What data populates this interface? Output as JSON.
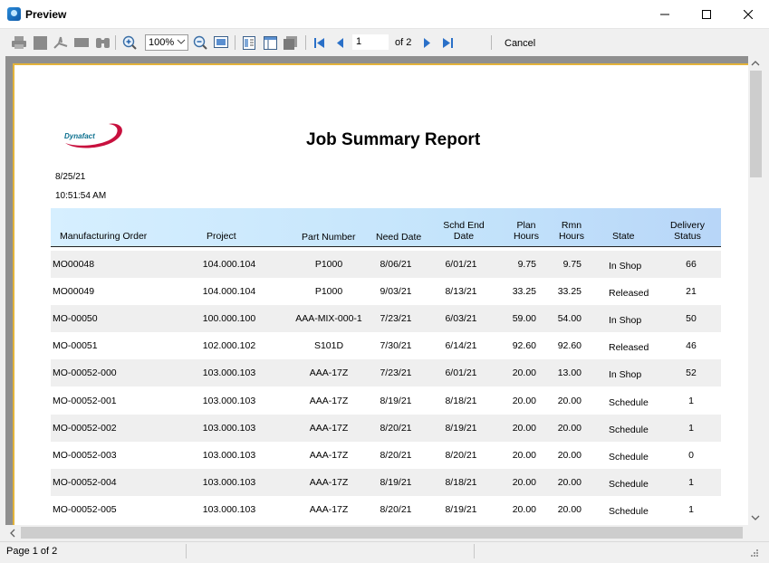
{
  "window": {
    "title": "Preview"
  },
  "toolbar": {
    "zoom_value": "100%",
    "page_number": "1",
    "page_of": "of 2",
    "cancel_label": "Cancel"
  },
  "report": {
    "logo_text": "Dynafact",
    "title": "Job Summary Report",
    "date": "8/25/21",
    "time": "10:51:54 AM",
    "columns": {
      "mo": "Manufacturing Order",
      "project": "Project",
      "part": "Part Number",
      "need": "Need Date",
      "schd_1": "Schd End",
      "schd_2": "Date",
      "plan_1": "Plan",
      "plan_2": "Hours",
      "rmn_1": "Rmn",
      "rmn_2": "Hours",
      "state": "State",
      "delivery_1": "Delivery",
      "delivery_2": "Status"
    },
    "rows": [
      {
        "mo": "MO00048",
        "project": "104.000.104",
        "part": "P1000",
        "need": "8/06/21",
        "schd": "6/01/21",
        "plan": "9.75",
        "rmn": "9.75",
        "state": "In Shop",
        "status": "66"
      },
      {
        "mo": "MO00049",
        "project": "104.000.104",
        "part": "P1000",
        "need": "9/03/21",
        "schd": "8/13/21",
        "plan": "33.25",
        "rmn": "33.25",
        "state": "Released",
        "status": "21"
      },
      {
        "mo": "MO-00050",
        "project": "100.000.100",
        "part": "AAA-MIX-000-1",
        "need": "7/23/21",
        "schd": "6/03/21",
        "plan": "59.00",
        "rmn": "54.00",
        "state": "In Shop",
        "status": "50"
      },
      {
        "mo": "MO-00051",
        "project": "102.000.102",
        "part": "S101D",
        "need": "7/30/21",
        "schd": "6/14/21",
        "plan": "92.60",
        "rmn": "92.60",
        "state": "Released",
        "status": "46"
      },
      {
        "mo": "MO-00052-000",
        "project": "103.000.103",
        "part": "AAA-17Z",
        "need": "7/23/21",
        "schd": "6/01/21",
        "plan": "20.00",
        "rmn": "13.00",
        "state": "In Shop",
        "status": "52"
      },
      {
        "mo": "MO-00052-001",
        "project": "103.000.103",
        "part": "AAA-17Z",
        "need": "8/19/21",
        "schd": "8/18/21",
        "plan": "20.00",
        "rmn": "20.00",
        "state": "Schedule",
        "status": "1"
      },
      {
        "mo": "MO-00052-002",
        "project": "103.000.103",
        "part": "AAA-17Z",
        "need": "8/20/21",
        "schd": "8/19/21",
        "plan": "20.00",
        "rmn": "20.00",
        "state": "Schedule",
        "status": "1"
      },
      {
        "mo": "MO-00052-003",
        "project": "103.000.103",
        "part": "AAA-17Z",
        "need": "8/20/21",
        "schd": "8/20/21",
        "plan": "20.00",
        "rmn": "20.00",
        "state": "Schedule",
        "status": "0"
      },
      {
        "mo": "MO-00052-004",
        "project": "103.000.103",
        "part": "AAA-17Z",
        "need": "8/19/21",
        "schd": "8/18/21",
        "plan": "20.00",
        "rmn": "20.00",
        "state": "Schedule",
        "status": "1"
      },
      {
        "mo": "MO-00052-005",
        "project": "103.000.103",
        "part": "AAA-17Z",
        "need": "8/20/21",
        "schd": "8/19/21",
        "plan": "20.00",
        "rmn": "20.00",
        "state": "Schedule",
        "status": "1"
      }
    ]
  },
  "statusbar": {
    "page_text": "Page 1 of 2"
  },
  "colors": {
    "page_border": "#e3b33a",
    "header_gradient_start": "#d6efff",
    "header_gradient_end": "#b8d6f8",
    "nav_arrow": "#2a70c8"
  }
}
